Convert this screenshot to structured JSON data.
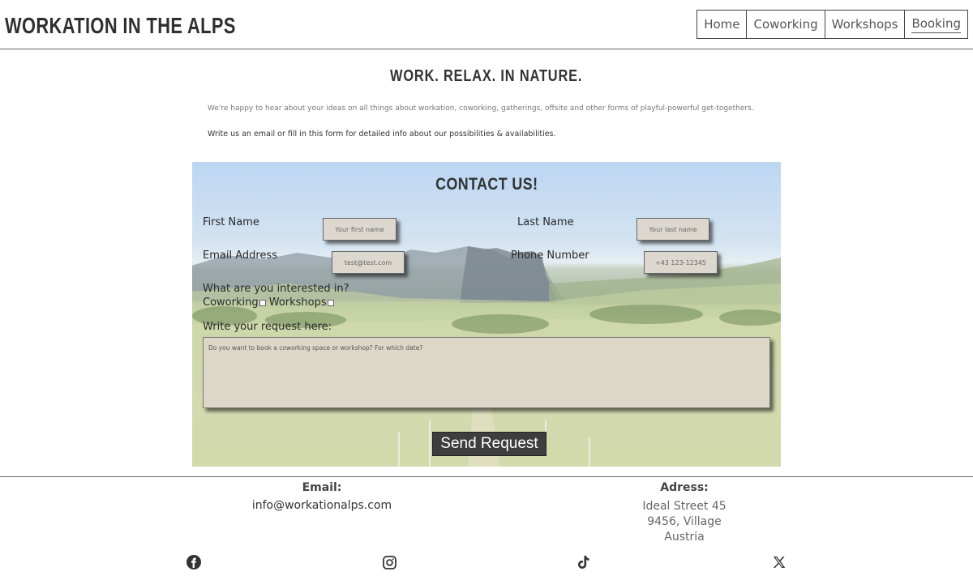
{
  "header": {
    "title": "WORKATION IN THE ALPS",
    "nav": [
      {
        "label": "Home"
      },
      {
        "label": "Coworking"
      },
      {
        "label": "Workshops"
      },
      {
        "label": "Booking"
      }
    ]
  },
  "intro": {
    "tagline": "WORK. RELAX. IN NATURE.",
    "text1": "We're happy to hear about your ideas on all things about workation, coworking, gatherings, offsite and other forms of playful-powerful get-togethers.",
    "text2": "Write us an email or fill in this form for detailed info about our possibilities & availabilities."
  },
  "form": {
    "title": "CONTACT US!",
    "first_name_label": "First Name",
    "first_name_placeholder": "Your first name",
    "last_name_label": "Last Name",
    "last_name_placeholder": "Your last name",
    "email_label": "Email Address",
    "email_placeholder": "test@test.com",
    "phone_label": "Phone Number",
    "phone_placeholder": "+43 123-12345",
    "interest_label": "What are you interested in?",
    "option_coworking": "Coworking",
    "option_workshops": "Workshops",
    "request_label": "Write your request here:",
    "request_placeholder": "Do you want to book a coworking space or workshop? For which date?",
    "submit_label": "Send Request"
  },
  "footer": {
    "email_label": "Email:",
    "email_value": "info@workationalps.com",
    "address_label": "Adress:",
    "address_line1": "Ideal Street 45",
    "address_line2": "9456, Village",
    "address_line3": "Austria",
    "social": [
      "facebook-icon",
      "instagram-icon",
      "tiktok-icon",
      "x-icon"
    ]
  }
}
